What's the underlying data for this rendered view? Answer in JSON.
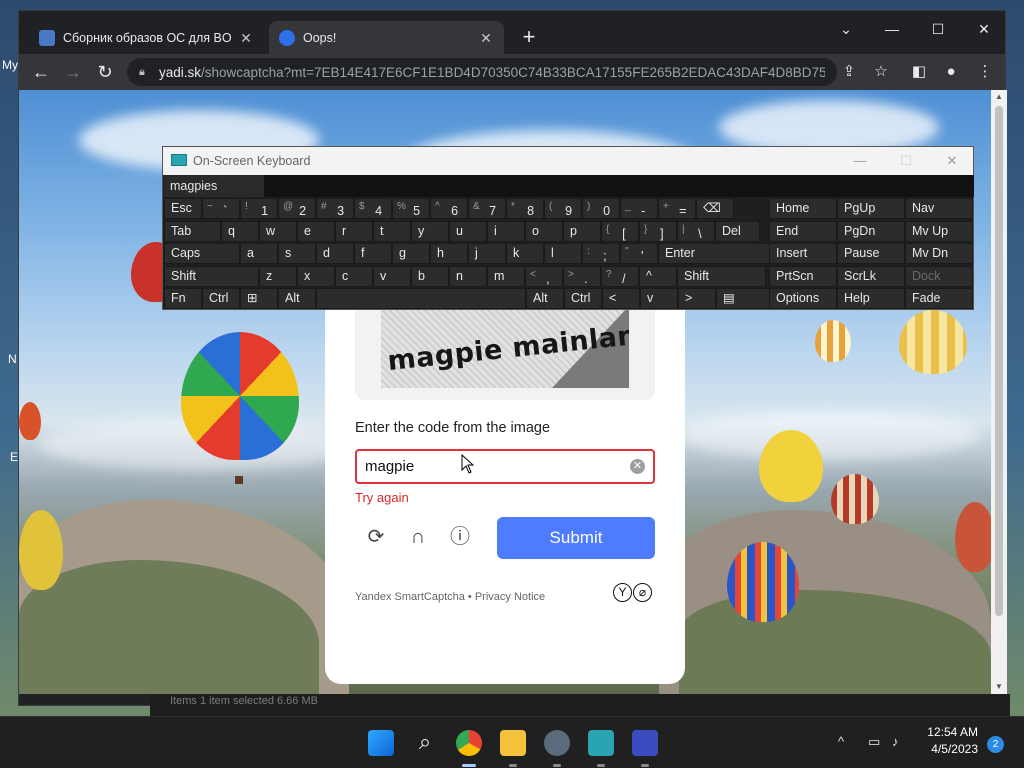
{
  "desktop": {
    "labels": [
      "My",
      "N",
      "E"
    ]
  },
  "browser": {
    "tabs": [
      {
        "title": "Сборник образов ОС для BOCH",
        "active": false,
        "icon": "site-favicon"
      },
      {
        "title": "Oops!",
        "active": true,
        "icon": "yandex-disk-favicon"
      }
    ],
    "new_tab": "+",
    "window_controls": {
      "dropdown": "⌄",
      "minimize": "—",
      "maximize": "☐",
      "close": "✕"
    },
    "nav": {
      "back": "←",
      "forward": "→",
      "reload": "↻"
    },
    "url_host": "yadi.sk",
    "url_path": "/showcaptcha?mt=7EB14E417E6CF1E1BD4D70350C74B33BCA17155FE265B2EDAC43DAF4D8BD757...",
    "toolbar_icons": [
      "share-icon",
      "bookmark-star-icon",
      "sidepanel-icon",
      "profile-icon",
      "menu-icon"
    ]
  },
  "captcha": {
    "image_text": "magpie mainland",
    "prompt": "Enter the code from the image",
    "input_value": "magpie",
    "error": "Try again",
    "submit_label": "Submit",
    "footer_brand": "Yandex SmartCaptcha",
    "footer_sep": " • ",
    "footer_privacy": "Privacy Notice",
    "logo_letters": [
      "Y",
      "⌀"
    ],
    "colors": {
      "accent": "#4d7cfe",
      "error": "#d62a2a"
    }
  },
  "osk": {
    "title": "On-Screen Keyboard",
    "prediction": "magpies",
    "rows": [
      [
        {
          "label": "Esc"
        },
        {
          "sub": "~",
          "main": "`"
        },
        {
          "sub": "!",
          "main": "1"
        },
        {
          "sub": "@",
          "main": "2"
        },
        {
          "sub": "#",
          "main": "3"
        },
        {
          "sub": "$",
          "main": "4"
        },
        {
          "sub": "%",
          "main": "5"
        },
        {
          "sub": "^",
          "main": "6"
        },
        {
          "sub": "&",
          "main": "7"
        },
        {
          "sub": "*",
          "main": "8"
        },
        {
          "sub": "(",
          "main": "9"
        },
        {
          "sub": ")",
          "main": "0"
        },
        {
          "sub": "_",
          "main": "-"
        },
        {
          "sub": "+",
          "main": "="
        },
        {
          "label": "⌫"
        }
      ],
      [
        {
          "label": "Tab"
        },
        {
          "label": "q"
        },
        {
          "label": "w"
        },
        {
          "label": "e"
        },
        {
          "label": "r"
        },
        {
          "label": "t"
        },
        {
          "label": "y"
        },
        {
          "label": "u"
        },
        {
          "label": "i"
        },
        {
          "label": "o"
        },
        {
          "label": "p"
        },
        {
          "sub": "{",
          "main": "["
        },
        {
          "sub": "}",
          "main": "]"
        },
        {
          "sub": "|",
          "main": "\\"
        },
        {
          "label": "Del"
        }
      ],
      [
        {
          "label": "Caps"
        },
        {
          "label": "a"
        },
        {
          "label": "s"
        },
        {
          "label": "d"
        },
        {
          "label": "f"
        },
        {
          "label": "g"
        },
        {
          "label": "h"
        },
        {
          "label": "j"
        },
        {
          "label": "k"
        },
        {
          "label": "l"
        },
        {
          "sub": ":",
          "main": ";"
        },
        {
          "sub": "\"",
          "main": "'"
        },
        {
          "label": "Enter"
        }
      ],
      [
        {
          "label": "Shift"
        },
        {
          "label": "z"
        },
        {
          "label": "x"
        },
        {
          "label": "c"
        },
        {
          "label": "v"
        },
        {
          "label": "b"
        },
        {
          "label": "n"
        },
        {
          "label": "m"
        },
        {
          "sub": "<",
          "main": ","
        },
        {
          "sub": ">",
          "main": "."
        },
        {
          "sub": "?",
          "main": "/"
        },
        {
          "label": "^"
        },
        {
          "label": "Shift"
        }
      ],
      [
        {
          "label": "Fn"
        },
        {
          "label": "Ctrl"
        },
        {
          "label": "⊞"
        },
        {
          "label": "Alt"
        },
        {
          "label": ""
        },
        {
          "label": "Alt"
        },
        {
          "label": "Ctrl"
        },
        {
          "label": "<"
        },
        {
          "label": "v"
        },
        {
          "label": ">"
        },
        {
          "label": "▤"
        }
      ]
    ],
    "nav_keys": [
      [
        "Home",
        "PgUp",
        "Nav"
      ],
      [
        "End",
        "PgDn",
        "Mv Up"
      ],
      [
        "Insert",
        "Pause",
        "Mv Dn"
      ],
      [
        "PrtScn",
        "ScrLk",
        "Dock"
      ],
      [
        "Options",
        "Help",
        "Fade"
      ]
    ]
  },
  "explorer_strip": "Items   1 item selected  6.66 MB",
  "taskbar": {
    "apps": [
      "windows-start-icon",
      "search-icon",
      "chrome-icon",
      "file-explorer-icon",
      "settings-icon",
      "remote-desktop-icon",
      "monitor-icon"
    ],
    "time": "12:54 AM",
    "date": "4/5/2023",
    "notification_count": "2"
  }
}
